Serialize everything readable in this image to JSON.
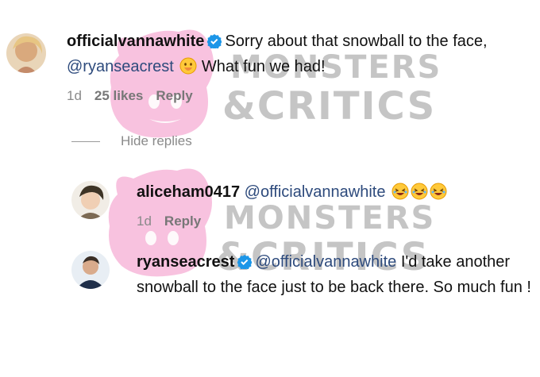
{
  "comments": [
    {
      "username": "officialvannawhite",
      "verified": true,
      "text_before": "Sorry about that snowball to the face,",
      "mention": "@ryanseacrest",
      "emojis": [
        "face-with-hand-over-mouth-emoji"
      ],
      "text_after": "What fun we had!",
      "time": "1d",
      "likes": "25 likes",
      "reply": "Reply"
    }
  ],
  "hide_replies": "Hide replies",
  "replies": [
    {
      "username": "aliceham0417",
      "verified": false,
      "mention": "@officialvannawhite",
      "emojis": [
        "laughing-emoji",
        "laughing-emoji",
        "laughing-emoji"
      ],
      "time": "1d",
      "reply": "Reply"
    },
    {
      "username": "ryanseacrest",
      "verified": true,
      "mention": "@officialvannawhite",
      "text": "I'd take another snowball to the face just to be back there. So much fun !"
    }
  ],
  "watermark": {
    "line1": "MONSTERS",
    "line2": "&CRITICS"
  },
  "colors": {
    "verified": "#1c96e8",
    "mention": "#2d4a7c",
    "meta": "#8a8a8a",
    "watermark_pink": "#f6b6d8",
    "watermark_gray": "#9a9a9a"
  }
}
